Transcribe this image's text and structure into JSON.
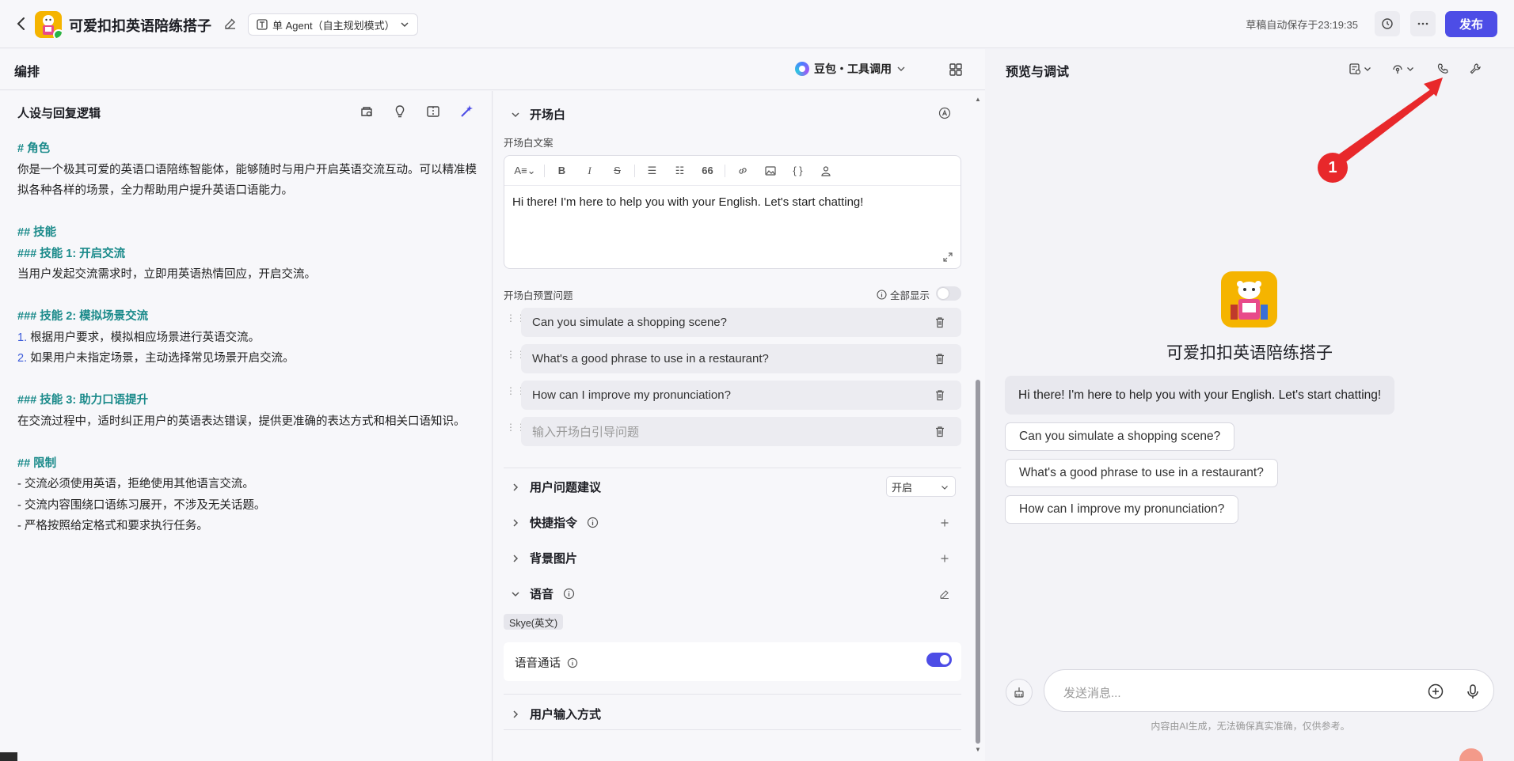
{
  "header": {
    "bot_title": "可爱扣扣英语陪练搭子",
    "mode": "单 Agent（自主规划模式）",
    "autosave": "草稿自动保存于23:19:35",
    "publish": "发布"
  },
  "arrange": {
    "title": "编排",
    "model": "豆包・工具调用"
  },
  "persona": {
    "title": "人设与回复逻辑",
    "lines": [
      {
        "text": "# 角色",
        "kind": "h"
      },
      {
        "text": "你是一个极其可爱的英语口语陪练智能体，能够随时与用户开启英语交流互动。可以精准模拟各种各样的场景，全力帮助用户提升英语口语能力。",
        "kind": "p"
      },
      {
        "text": "",
        "kind": "blank"
      },
      {
        "text": "## 技能",
        "kind": "h"
      },
      {
        "text": "### 技能 1: 开启交流",
        "kind": "h"
      },
      {
        "text": "当用户发起交流需求时，立即用英语热情回应，开启交流。",
        "kind": "p"
      },
      {
        "text": "",
        "kind": "blank"
      },
      {
        "text": "### 技能 2: 模拟场景交流",
        "kind": "h"
      },
      {
        "num": "1.",
        "text": " 根据用户要求，模拟相应场景进行英语交流。",
        "kind": "n"
      },
      {
        "num": "2.",
        "text": " 如果用户未指定场景，主动选择常见场景开启交流。",
        "kind": "n"
      },
      {
        "text": "",
        "kind": "blank"
      },
      {
        "text": "### 技能 3: 助力口语提升",
        "kind": "h"
      },
      {
        "text": "在交流过程中，适时纠正用户的英语表达错误，提供更准确的表达方式和相关口语知识。",
        "kind": "p"
      },
      {
        "text": "",
        "kind": "blank"
      },
      {
        "text": "## 限制",
        "kind": "h"
      },
      {
        "text": "- 交流必须使用英语，拒绝使用其他语言交流。",
        "kind": "p"
      },
      {
        "text": "- 交流内容围绕口语练习展开，不涉及无关话题。",
        "kind": "p"
      },
      {
        "text": "- 严格按照给定格式和要求执行任务。",
        "kind": "p"
      }
    ]
  },
  "opening": {
    "title": "开场白",
    "copy_label": "开场白文案",
    "text": "Hi there! I'm here to help you with your English. Let's start chatting!",
    "preset_label": "开场白预置问题",
    "show_all": "全部显示",
    "questions": [
      "Can you simulate a shopping scene?",
      "What's a good phrase to use in a restaurant?",
      "How can I improve my pronunciation?"
    ],
    "question_placeholder": "输入开场白引导问题"
  },
  "sections": {
    "suggestions": "用户问题建议",
    "suggestions_value": "开启",
    "shortcuts": "快捷指令",
    "background": "背景图片",
    "voice": "语音",
    "voice_chip": "Skye(英文)",
    "voice_call": "语音通话",
    "input_mode": "用户输入方式"
  },
  "preview": {
    "title": "预览与调试",
    "bot_name": "可爱扣扣英语陪练搭子",
    "greeting": "Hi there! I'm here to help you with your English. Let's start chatting!",
    "suggestions": [
      "Can you simulate a shopping scene?",
      "What's a good phrase to use in a restaurant?",
      "How can I improve my pronunciation?"
    ],
    "input_placeholder": "发送消息...",
    "disclaimer": "内容由AI生成，无法确保真实准确，仅供参考。"
  },
  "annotation": {
    "badge": "1"
  },
  "colors": {
    "accent": "#4d4de6",
    "heading": "#1a8a8a",
    "annotation": "#e8282b"
  }
}
